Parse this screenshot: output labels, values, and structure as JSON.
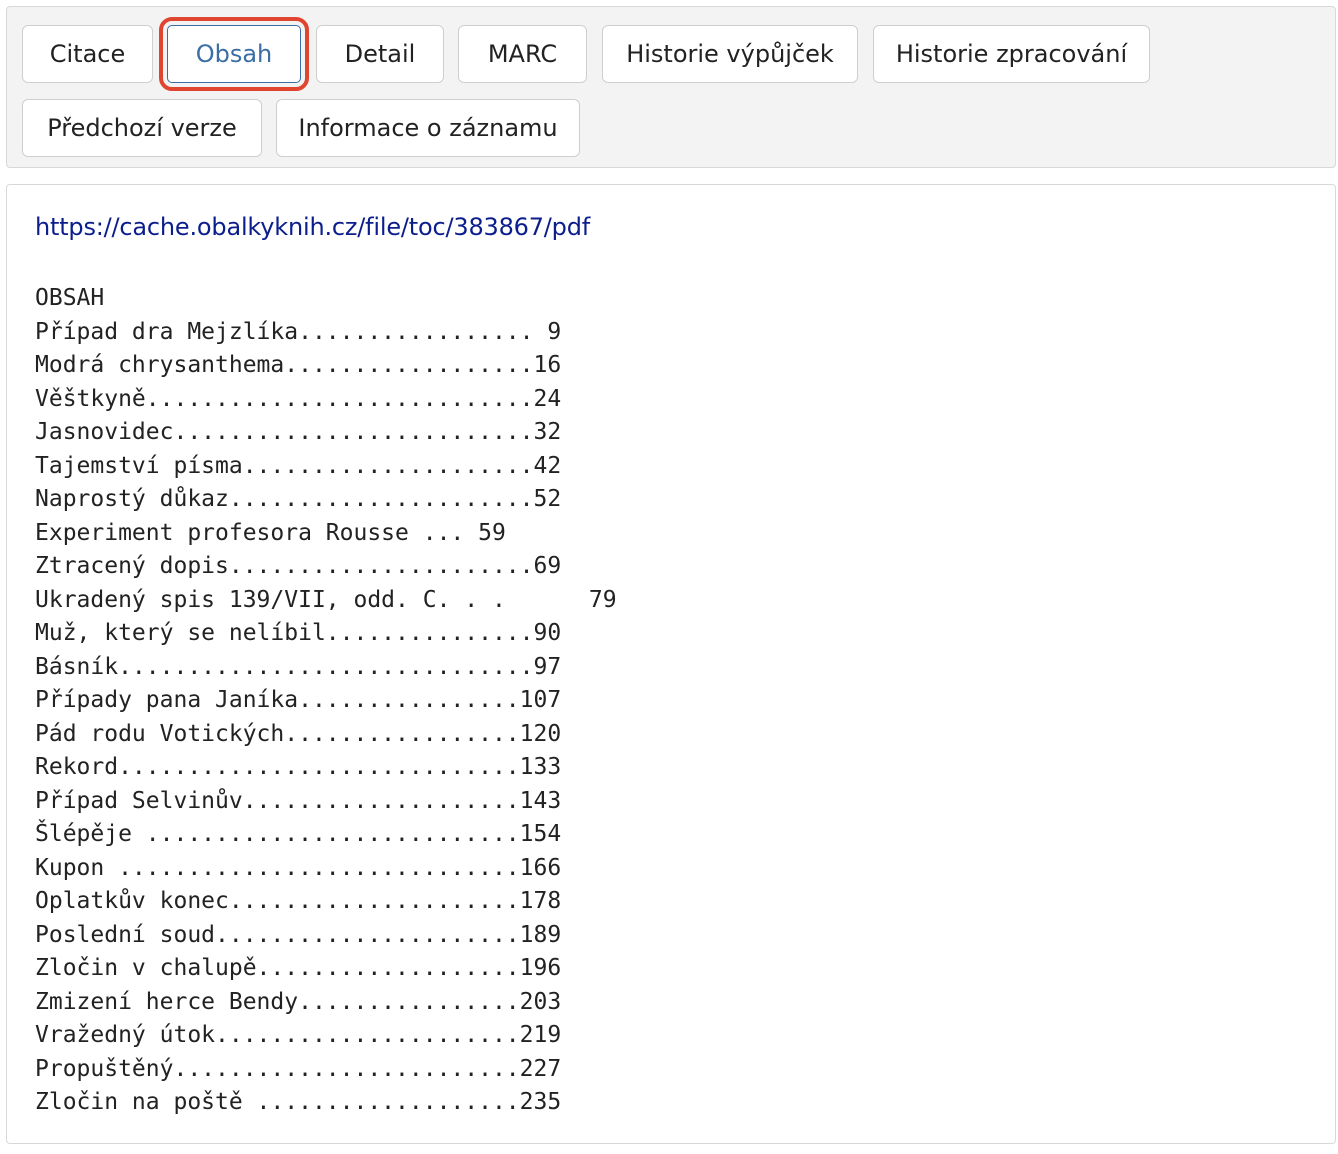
{
  "tabs": [
    {
      "label": "Citace",
      "active": false
    },
    {
      "label": "Obsah",
      "active": true
    },
    {
      "label": "Detail",
      "active": false
    },
    {
      "label": "MARC",
      "active": false
    },
    {
      "label": "Historie výpůjček",
      "active": false
    },
    {
      "label": "Historie zpracování",
      "active": false
    },
    {
      "label": "Předchozí verze",
      "active": false
    },
    {
      "label": "Informace o záznamu",
      "active": false
    }
  ],
  "content": {
    "link": "https://cache.obalkyknih.cz/file/toc/383867/pdf",
    "heading": "OBSAH",
    "lines": [
      "Případ dra Mejzlíka................. 9",
      "Modrá chrysanthema..................16",
      "Věštkyně............................24",
      "Jasnovidec..........................32",
      "Tajemství písma.....................42",
      "Naprostý důkaz......................52",
      "Experiment profesora Rousse ... 59",
      "Ztracený dopis......................69",
      "Ukradený spis 139/VII, odd. C. . .      79",
      "Muž, který se nelíbil...............90",
      "Básník..............................97",
      "Případy pana Janíka................107",
      "Pád rodu Votických.................120",
      "Rekord.............................133",
      "Případ Selvinův....................143",
      "Šlépěje ...........................154",
      "Kupon .............................166",
      "Oplatkův konec.....................178",
      "Poslední soud......................189",
      "Zločin v chalupě...................196",
      "Zmizení herce Bendy................203",
      "Vražedný útok......................219",
      "Propuštěný.........................227",
      "Zločin na poště ...................235"
    ]
  }
}
